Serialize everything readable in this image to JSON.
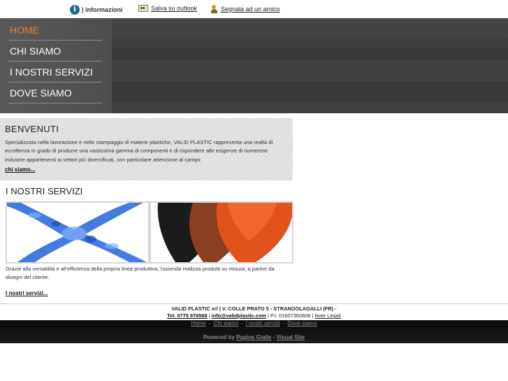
{
  "topbar": {
    "info_icon_letter": "i",
    "info_label": "| informazioni",
    "outlook_label": "Salva su outlook",
    "friend_label": "Segnala ad un amico"
  },
  "nav": {
    "items": [
      {
        "label": "HOME"
      },
      {
        "label": "CHI SIAMO"
      },
      {
        "label": "I NOSTRI SERVIZI"
      },
      {
        "label": "DOVE SIAMO"
      }
    ],
    "active_color": "#f07d1a"
  },
  "welcome": {
    "title": "BENVENUTI",
    "text": "Specializzata nella lavorazione e nello stampaggio di materie plastiche, VALID PLASTIC rappresenta una realtà di eccellenza in grado di produrre una vastissima gamma di componenti e di rispondere alle esigenze di numerose industrie appartenenti ai settori più diversificati, con particolare attenzione al campo",
    "link": "chi siamo..."
  },
  "services": {
    "title": "I NOSTRI SERVIZI",
    "text": "Grazie alla versatilità e all'efficienza della propria linea produttiva, l'azienda realizza prodotti su misura, a partire da disegni del cliente.",
    "link": "I nostri servizi..."
  },
  "footer": {
    "company": "VALID PLASTIC srl | V. COLLE PRATO 5 - STRANGOLAGALLI (FR) -",
    "phone": "Tel. 0775 978568",
    "sep1": "|",
    "email": "info@validplastic.com",
    "vat": "| P.I. 01607350608 |",
    "legal": "Note Legali"
  },
  "bottomnav": {
    "home": "Home",
    "chi_siamo": "Chi siamo",
    "servizi": "I nostri servizi",
    "dove_siamo": "Dove siamo",
    "sep": "-"
  },
  "powered": {
    "label": "Powered by",
    "pagine_gialle": "Pagine Gialle",
    "dash": "-",
    "visual_site": "Visual Site"
  }
}
